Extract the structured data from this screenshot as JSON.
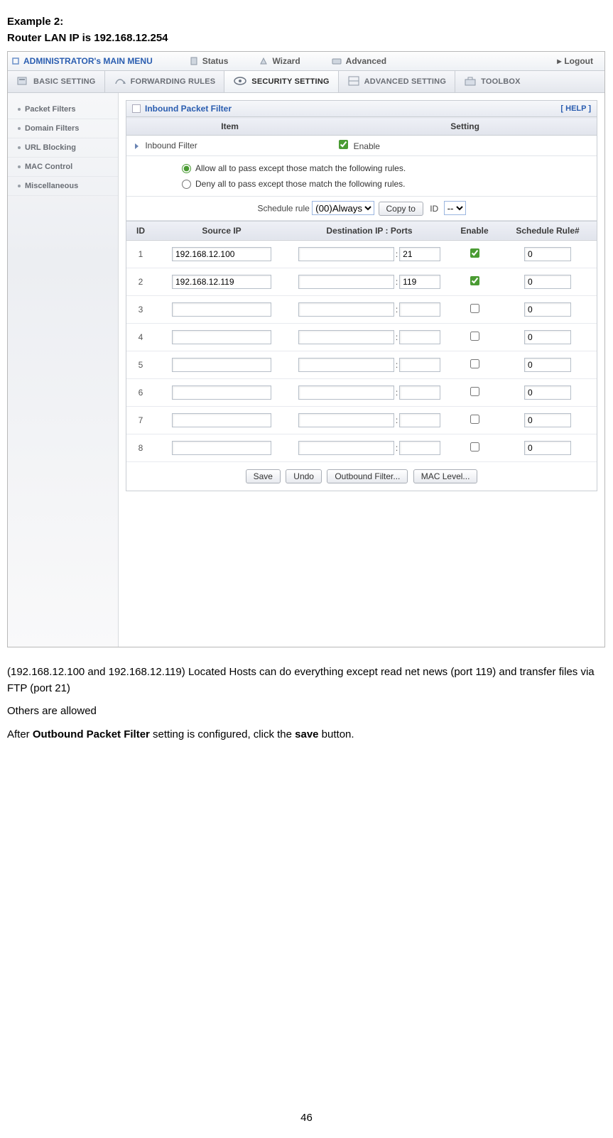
{
  "doc": {
    "example_label": "Example 2:",
    "router_ip_line": "Router LAN IP is 192.168.12.254",
    "paragraph1": "(192.168.12.100 and 192.168.12.119) Located Hosts can do everything except read net news (port 119) and transfer files via FTP (port 21)",
    "paragraph2": "Others are allowed",
    "paragraph3_pre": "After ",
    "paragraph3_bold1": "Outbound Packet Filter",
    "paragraph3_mid": " setting is configured, click the ",
    "paragraph3_bold2": "save",
    "paragraph3_post": " button.",
    "page_number": "46"
  },
  "topbar": {
    "admin": "ADMINISTRATOR's MAIN MENU",
    "status": "Status",
    "wizard": "Wizard",
    "advanced": "Advanced",
    "logout": "Logout"
  },
  "tabs": {
    "basic": "BASIC SETTING",
    "forwarding": "FORWARDING RULES",
    "security": "SECURITY SETTING",
    "advanced": "ADVANCED SETTING",
    "toolbox": "TOOLBOX"
  },
  "sidebar": {
    "items": [
      "Packet Filters",
      "Domain Filters",
      "URL Blocking",
      "MAC Control",
      "Miscellaneous"
    ]
  },
  "panel": {
    "title": "Inbound Packet Filter",
    "help": "[ HELP ]",
    "thead_item": "Item",
    "thead_setting": "Setting",
    "inbound_label": "Inbound Filter",
    "enable_label": "Enable",
    "enable_checked": true,
    "radio_allow": "Allow all to pass except those match the following rules.",
    "radio_deny": "Deny all to pass except those match the following rules.",
    "radio_selected": "allow",
    "schedule_label": "Schedule rule",
    "schedule_select": "(00)Always",
    "copyto_label": "Copy to",
    "id_label": "ID",
    "id_select": "--"
  },
  "rules": {
    "headers": {
      "id": "ID",
      "source": "Source IP",
      "dest": "Destination IP : Ports",
      "enable": "Enable",
      "sched": "Schedule Rule#"
    },
    "rows": [
      {
        "id": "1",
        "source": "192.168.12.100",
        "dest": "",
        "port": "21",
        "enable": true,
        "sched": "0"
      },
      {
        "id": "2",
        "source": "192.168.12.119",
        "dest": "",
        "port": "119",
        "enable": true,
        "sched": "0"
      },
      {
        "id": "3",
        "source": "",
        "dest": "",
        "port": "",
        "enable": false,
        "sched": "0"
      },
      {
        "id": "4",
        "source": "",
        "dest": "",
        "port": "",
        "enable": false,
        "sched": "0"
      },
      {
        "id": "5",
        "source": "",
        "dest": "",
        "port": "",
        "enable": false,
        "sched": "0"
      },
      {
        "id": "6",
        "source": "",
        "dest": "",
        "port": "",
        "enable": false,
        "sched": "0"
      },
      {
        "id": "7",
        "source": "",
        "dest": "",
        "port": "",
        "enable": false,
        "sched": "0"
      },
      {
        "id": "8",
        "source": "",
        "dest": "",
        "port": "",
        "enable": false,
        "sched": "0"
      }
    ]
  },
  "buttons": {
    "save": "Save",
    "undo": "Undo",
    "outbound": "Outbound Filter...",
    "mac": "MAC Level..."
  }
}
